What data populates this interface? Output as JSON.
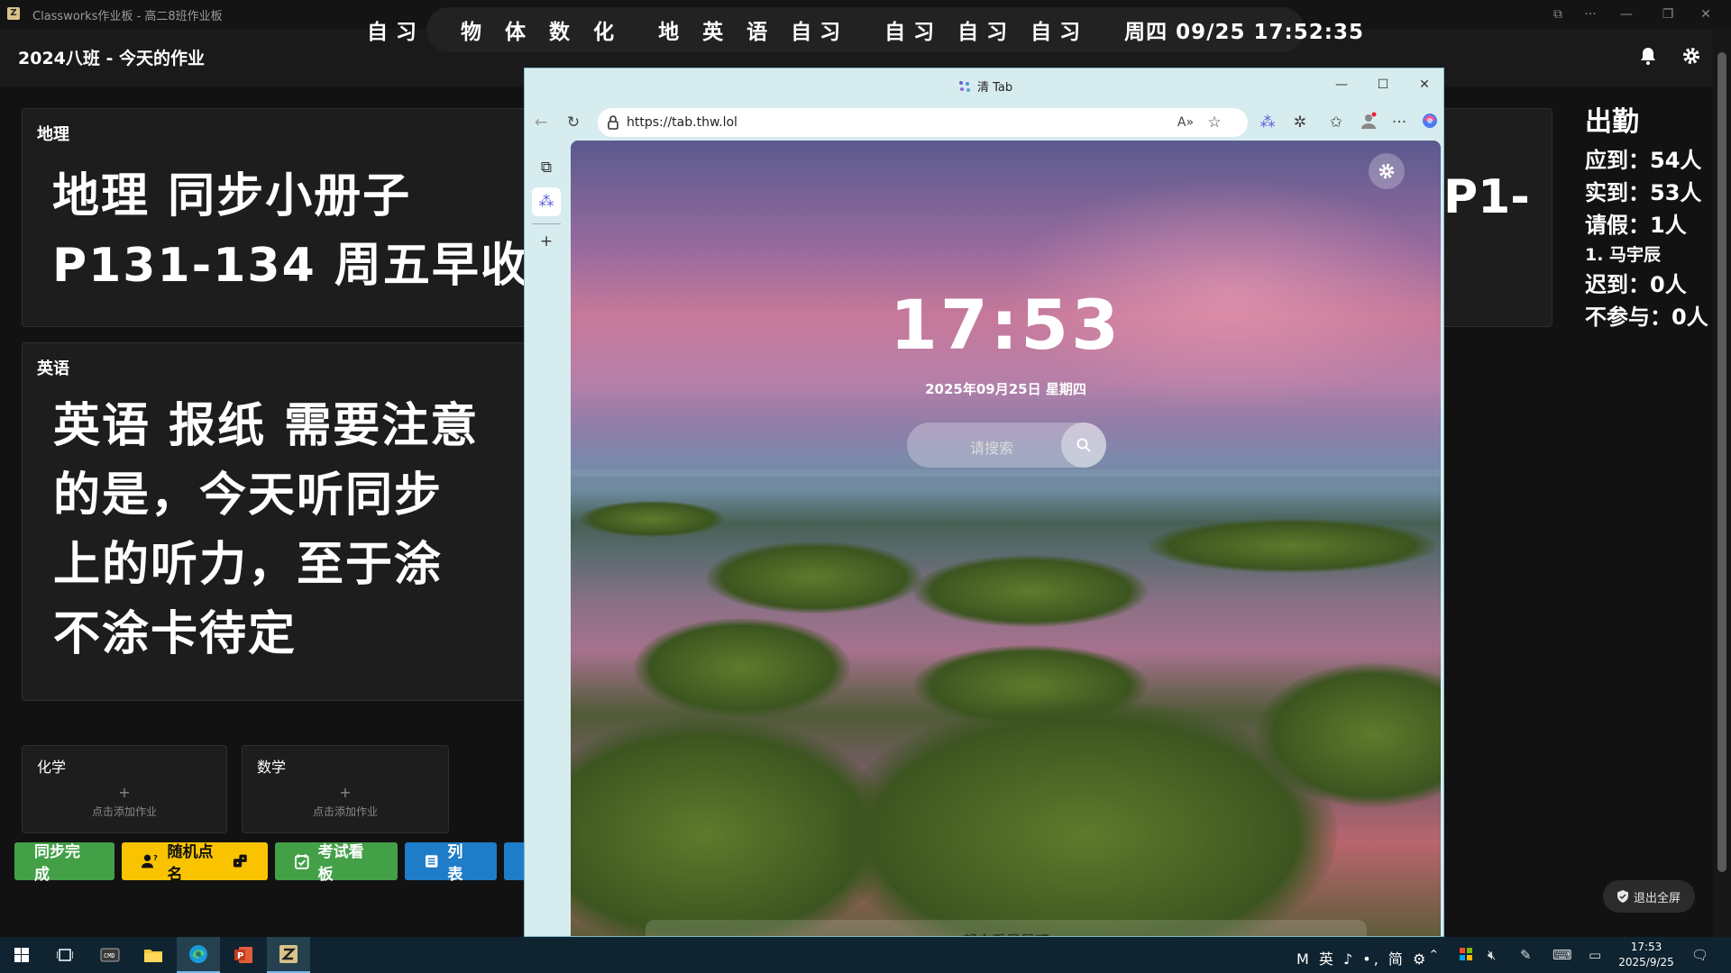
{
  "window": {
    "title": "Classworks作业板 - 高二8班作业板",
    "app_title": "2024八班 - 今天的作业"
  },
  "schedule": {
    "groups": [
      "自习",
      "物 体 数 化",
      "地 英 语 自习",
      "自习 自习 自习"
    ],
    "datetime": "周四 09/25 17:52:35"
  },
  "homework": {
    "geography": {
      "subject": "地理",
      "lines": [
        "地理 同步小册子",
        "P131-134 周五早收"
      ]
    },
    "english": {
      "subject": "英语",
      "lines": [
        "英语 报纸 需要注意",
        "的是，今天听同步",
        "上的听力，至于涂",
        "不涂卡待定"
      ]
    },
    "hidden_fragment": "P1-",
    "chemistry": {
      "subject": "化学",
      "plus": "+",
      "hint": "点击添加作业"
    },
    "math": {
      "subject": "数学",
      "plus": "+",
      "hint": "点击添加作业"
    }
  },
  "attendance": {
    "title": "出勤",
    "expected": "应到：54人",
    "present": "实到：53人",
    "leave": "请假：1人",
    "leave_name": "1. 马宇辰",
    "late": "迟到：0人",
    "absent": "不参与：0人"
  },
  "actions": [
    {
      "label": "同步完成",
      "color": "#43a047",
      "text_color": "#ffffff",
      "icon": "none"
    },
    {
      "label": "随机点名",
      "color": "#f9c300",
      "text_color": "#111111",
      "icon": "person-question-icon"
    },
    {
      "label": "考试看板",
      "color": "#43a047",
      "text_color": "#ffffff",
      "icon": "calendar-check-icon"
    },
    {
      "label": "列表",
      "color": "#1f7cc8",
      "text_color": "#ffffff",
      "icon": "list-icon"
    }
  ],
  "exit_fullscreen": "退出全屏",
  "browser": {
    "tab_title": "清 Tab",
    "url": "https://tab.thw.lol",
    "clock": "17:53",
    "date": "2025年09月25日 星期四",
    "search_placeholder": "请搜索",
    "quote": "一起去看星星吧。"
  },
  "taskbar": {
    "ime": "M 英 ♪ •, 简 ⚙",
    "time": "17:53",
    "date": "2025/9/25"
  },
  "colors": {
    "background": "#121212",
    "card": "#1d1d1d",
    "browser_frame": "#d7ecef",
    "taskbar": "#0f2430"
  }
}
